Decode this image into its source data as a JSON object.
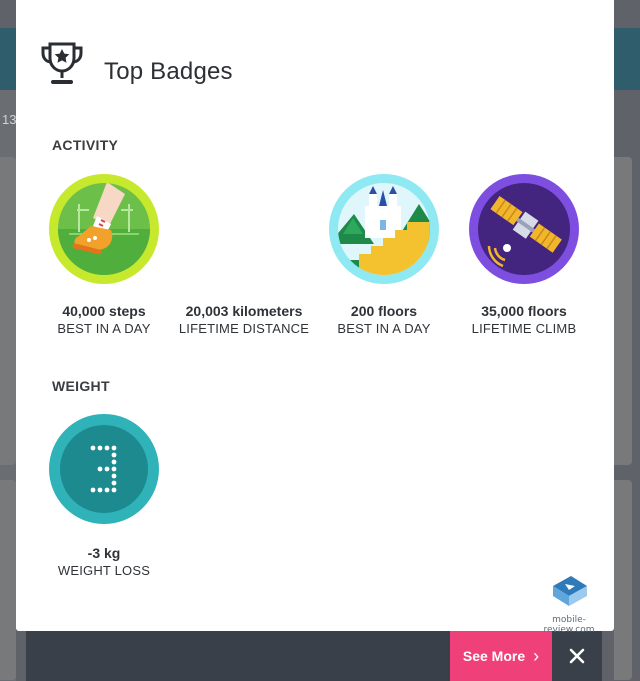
{
  "background": {
    "partial_number": "13"
  },
  "modal": {
    "title": "Top Badges",
    "sections": [
      {
        "heading": "ACTIVITY",
        "badges": [
          {
            "value": "40,000 steps",
            "label": "BEST IN A DAY",
            "icon": "sneaker-badge-icon",
            "color": "#c6e92d"
          },
          {
            "value": "20,003 kilometers",
            "label": "LIFETIME DISTANCE",
            "icon": "",
            "color": ""
          },
          {
            "value": "200 floors",
            "label": "BEST IN A DAY",
            "icon": "castle-badge-icon",
            "color": "#7fe3ee"
          },
          {
            "value": "35,000 floors",
            "label": "LIFETIME CLIMB",
            "icon": "satellite-badge-icon",
            "color": "#6a3fc8"
          }
        ]
      },
      {
        "heading": "WEIGHT",
        "badges": [
          {
            "value": "-3 kg",
            "label": "WEIGHT LOSS",
            "icon": "weight-3-badge-icon",
            "color": "#2fb3b8"
          }
        ]
      }
    ]
  },
  "footer": {
    "see_more_label": "See More",
    "accent": "#f0407a",
    "bar_color": "#3a4049"
  },
  "watermark": "mobile-review.com"
}
